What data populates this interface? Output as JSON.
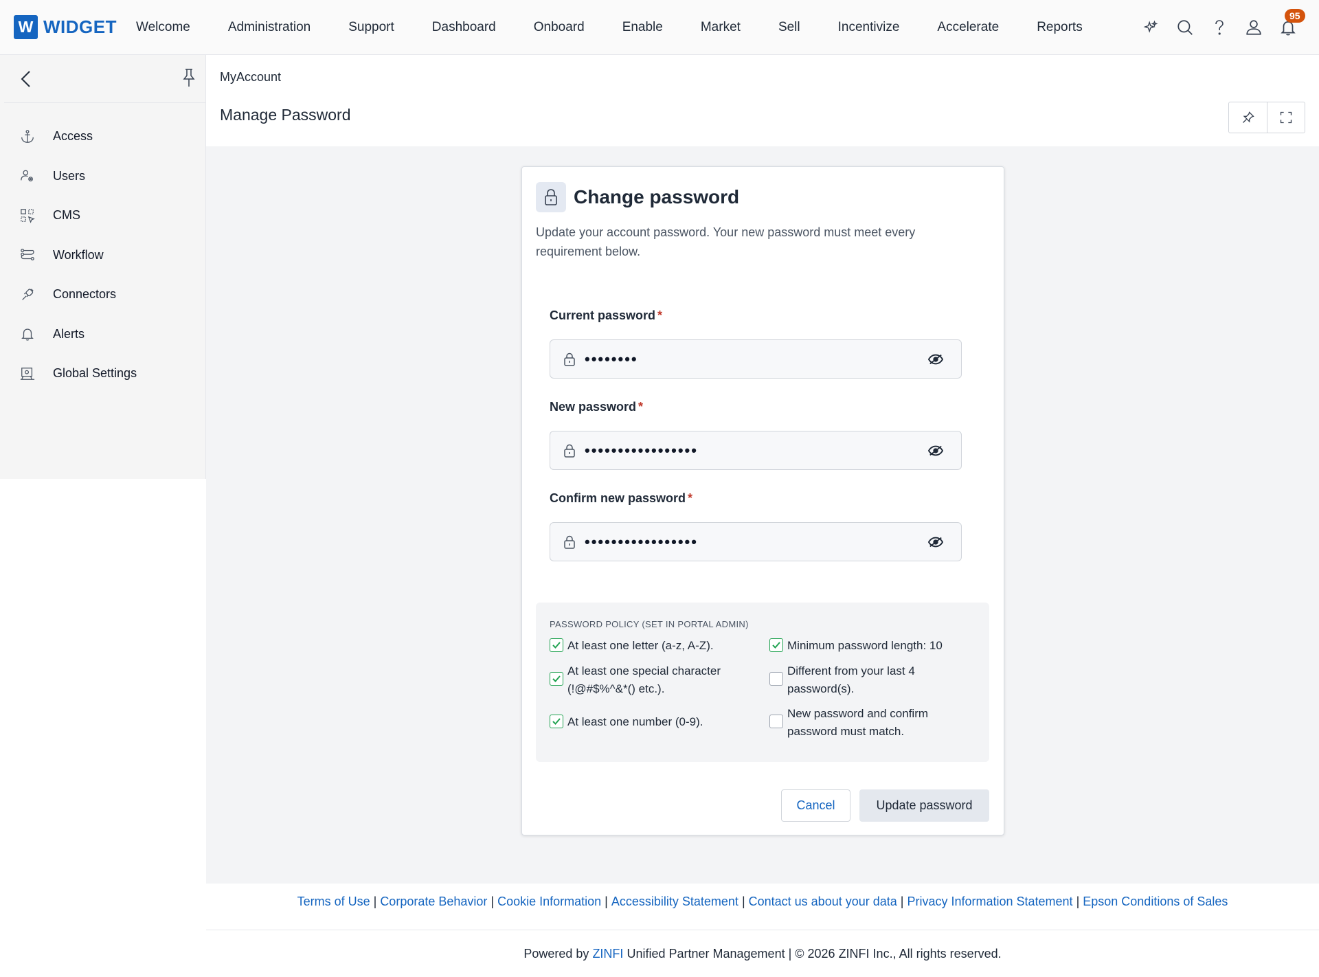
{
  "brand": {
    "mark": "W",
    "name": "WIDGET",
    "color": "#1565c0"
  },
  "topnav": [
    {
      "label": "Welcome"
    },
    {
      "label": "Administration"
    },
    {
      "label": "Support"
    },
    {
      "label": "Dashboard"
    },
    {
      "label": "Onboard"
    },
    {
      "label": "Enable"
    },
    {
      "label": "Market"
    },
    {
      "label": "Sell"
    },
    {
      "label": "Incentivize"
    },
    {
      "label": "Accelerate"
    },
    {
      "label": "Reports"
    }
  ],
  "top_icons": {
    "items": [
      "sparkle-icon",
      "search-icon",
      "help-icon",
      "user-icon",
      "bell-icon"
    ],
    "notification_count": "95"
  },
  "sidebar": {
    "items": [
      {
        "label": "Access",
        "icon": "anchor-icon"
      },
      {
        "label": "Users",
        "icon": "users-gear-icon"
      },
      {
        "label": "CMS",
        "icon": "cms-grid-icon"
      },
      {
        "label": "Workflow",
        "icon": "workflow-icon"
      },
      {
        "label": "Connectors",
        "icon": "plug-icon"
      },
      {
        "label": "Alerts",
        "icon": "bell-icon"
      },
      {
        "label": "Global Settings",
        "icon": "settings-monitor-icon"
      }
    ]
  },
  "page": {
    "breadcrumb": "MyAccount",
    "title": "Manage Password"
  },
  "card": {
    "title": "Change password",
    "description": "Update your account password. Your new password must meet every requirement below.",
    "fields": [
      {
        "label": "Current password",
        "required": "*",
        "value": "••••••••"
      },
      {
        "label": "New password",
        "required": "*",
        "value": "•••••••••••••••••"
      },
      {
        "label": "Confirm new password",
        "required": "*",
        "value": "•••••••••••••••••"
      }
    ],
    "policy": {
      "title": "PASSWORD POLICY (SET IN PORTAL ADMIN)",
      "rules": [
        {
          "text": "At least one letter (a-z, A-Z).",
          "checked": true
        },
        {
          "text": "Minimum password length: 10",
          "checked": true
        },
        {
          "text": "At least one special character (!@#$%^&*() etc.).",
          "checked": true
        },
        {
          "text": "Different from your last 4 password(s).",
          "checked": false
        },
        {
          "text": "At least one number (0-9).",
          "checked": true
        },
        {
          "text": "New password and confirm password must match.",
          "checked": false
        }
      ]
    },
    "cancel_label": "Cancel",
    "submit_label": "Update password"
  },
  "footer": {
    "links": [
      "Terms of Use",
      "Corporate Behavior",
      "Cookie Information",
      "Accessibility Statement",
      "Contact us about your data",
      "Privacy Information Statement",
      "Epson Conditions of Sales"
    ],
    "separator": "|",
    "powered_prefix": "Powered by",
    "powered_brand": "ZINFI",
    "powered_suffix": "Unified Partner Management | © 2026 ZINFI Inc., All rights reserved."
  },
  "colors": {
    "accent": "#1565c0",
    "badge": "#d4530c",
    "check": "#22a352",
    "required": "#c0392b"
  }
}
